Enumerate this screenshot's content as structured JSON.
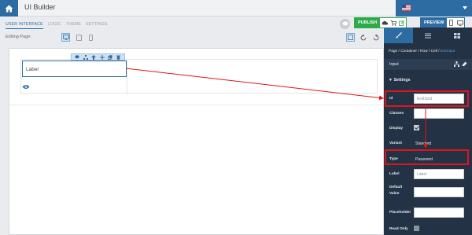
{
  "header": {
    "app_title": "UI Builder",
    "tabs": [
      "USER INTERFACE",
      "LOGIC",
      "THEME",
      "SETTINGS"
    ],
    "active_tab": "USER INTERFACE",
    "publish_label": "PUBLISH",
    "preview_label": "PREVIEW"
  },
  "editing": {
    "label": "Editing Page:"
  },
  "canvas": {
    "input_label": "Label"
  },
  "panel": {
    "breadcrumb": [
      "Page",
      "Container",
      "Row",
      "Cell",
      "textInput"
    ],
    "breadcrumb_sep": " / ",
    "component_name": "Input",
    "settings_heading": "Settings",
    "props": {
      "id_label": "Id",
      "id_value": "textInput",
      "classes_label": "Classes",
      "classes_value": "",
      "display_label": "Display",
      "display_checked": true,
      "variant_label": "Variant",
      "variant_value": "Standard",
      "type_label": "Type",
      "type_value": "Password",
      "label_label": "Label",
      "label_value": "Label",
      "default_value_label_1": "Default",
      "default_value_label_2": "Value",
      "default_value": "",
      "placeholder_label": "Placeholder",
      "placeholder_value": "",
      "read_only_label": "Read Only",
      "read_only_checked": false
    }
  },
  "colors": {
    "brand_blue": "#2d6ca3",
    "publish_green": "#2eaa4a",
    "panel_bg": "#233244",
    "highlight_red": "#e0151b",
    "breadcrumb_active": "#5aa2e0"
  }
}
